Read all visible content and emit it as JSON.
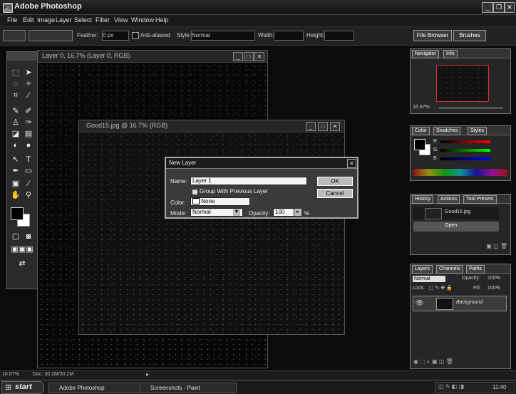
{
  "app": {
    "title": "Adobe Photoshop",
    "icon_text": "PS"
  },
  "menu": [
    "File",
    "Edit",
    "Image",
    "Layer",
    "Select",
    "Filter",
    "View",
    "Window",
    "Help"
  ],
  "options": {
    "feather_label": "Feather:",
    "feather_value": "0 px",
    "antialiased_label": "Anti-aliased",
    "style_label": "Style:",
    "style_value": "Normal",
    "width_label": "Width:",
    "height_label": "Height:",
    "tab_file_browser": "File Browser",
    "tab_brushes": "Brushes"
  },
  "doc1": {
    "title": "Layer 0, 16.7% (Layer 0, RGB)"
  },
  "doc2": {
    "title": "Good15.jpg @ 16.7% (RGB)"
  },
  "dialog": {
    "title": "New Layer",
    "name_label": "Name:",
    "name_value": "Layer 1",
    "group_label": "Group With Previous Layer",
    "color_label": "Color:",
    "color_value": "None",
    "mode_label": "Mode:",
    "mode_value": "Normal",
    "opacity_label": "Opacity:",
    "opacity_value": "100",
    "percent": "%",
    "ok": "OK",
    "cancel": "Cancel"
  },
  "panels": {
    "navigator": {
      "tabs": [
        "Navigator",
        "Info"
      ],
      "zoom": "16.67%"
    },
    "color": {
      "tabs": [
        "Color",
        "Swatches",
        "Styles"
      ],
      "channels": [
        "R",
        "G",
        "B"
      ]
    },
    "history": {
      "tabs": [
        "History",
        "Actions",
        "Tool Presets"
      ],
      "items": [
        "Good15.jpg",
        "Open"
      ]
    },
    "layers": {
      "tabs": [
        "Layers",
        "Channels",
        "Paths"
      ],
      "mode": "Normal",
      "opacity_label": "Opacity:",
      "opacity": "100%",
      "lock_label": "Lock:",
      "fill_label": "Fill:",
      "fill": "100%",
      "layer_name": "Background"
    }
  },
  "status": {
    "zoom": "16.67%",
    "doc": "Doc: 30.2M/30.2M"
  },
  "taskbar": {
    "start": "start",
    "tasks": [
      "Adobe Photoshop",
      "Screenshots - Paint"
    ],
    "clock": "11:40"
  },
  "colors": {
    "bg": "#0b0b0b",
    "chrome": "#262626",
    "dialog": "#3a3a3a",
    "foreground_swatch": "#000000",
    "background_swatch": "#ffffff"
  }
}
